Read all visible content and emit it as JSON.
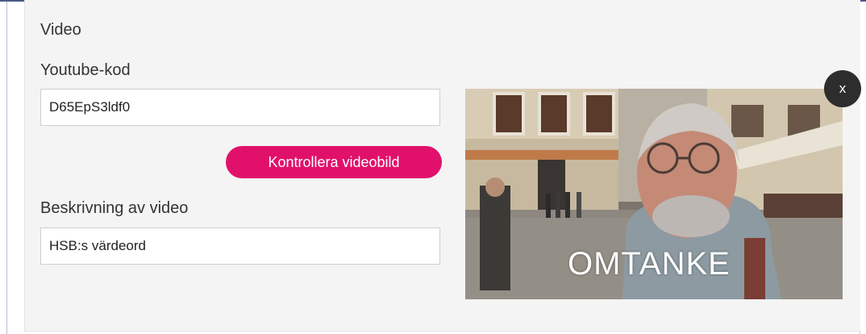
{
  "section": {
    "title": "Video"
  },
  "youtube": {
    "label": "Youtube-kod",
    "value": "D65EpS3ldf0"
  },
  "check_button": {
    "label": "Kontrollera videobild"
  },
  "description": {
    "label": "Beskrivning av video",
    "value": "HSB:s värdeord"
  },
  "video_thumbnail": {
    "caption": "OMTANKE"
  },
  "close_button": {
    "label": "x"
  },
  "colors": {
    "accent": "#e1116b",
    "panel": "#f4f4f4",
    "close": "#2d2d2d"
  }
}
